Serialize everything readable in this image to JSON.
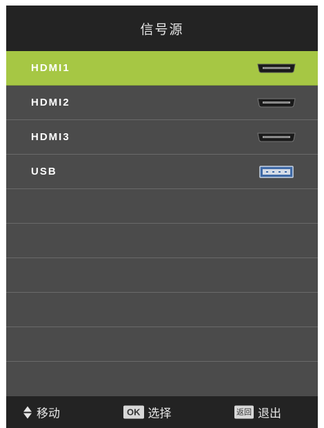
{
  "header": {
    "title": "信号源"
  },
  "sources": [
    {
      "label": "HDMI1",
      "icon": "hdmi-port-icon",
      "selected": true
    },
    {
      "label": "HDMI2",
      "icon": "hdmi-port-icon",
      "selected": false
    },
    {
      "label": "HDMI3",
      "icon": "hdmi-port-icon",
      "selected": false
    },
    {
      "label": "USB",
      "icon": "usb-port-icon",
      "selected": false
    },
    {
      "label": "",
      "selected": false
    },
    {
      "label": "",
      "selected": false
    },
    {
      "label": "",
      "selected": false
    },
    {
      "label": "",
      "selected": false
    },
    {
      "label": "",
      "selected": false
    },
    {
      "label": "",
      "selected": false
    }
  ],
  "footer": {
    "move_label": "移动",
    "ok_key": "OK",
    "ok_label": "选择",
    "back_key": "返回",
    "back_label": "退出"
  },
  "colors": {
    "panel": "#4b4b4b",
    "header": "#232323",
    "selected": "#a6c744",
    "text": "#ffffff"
  }
}
